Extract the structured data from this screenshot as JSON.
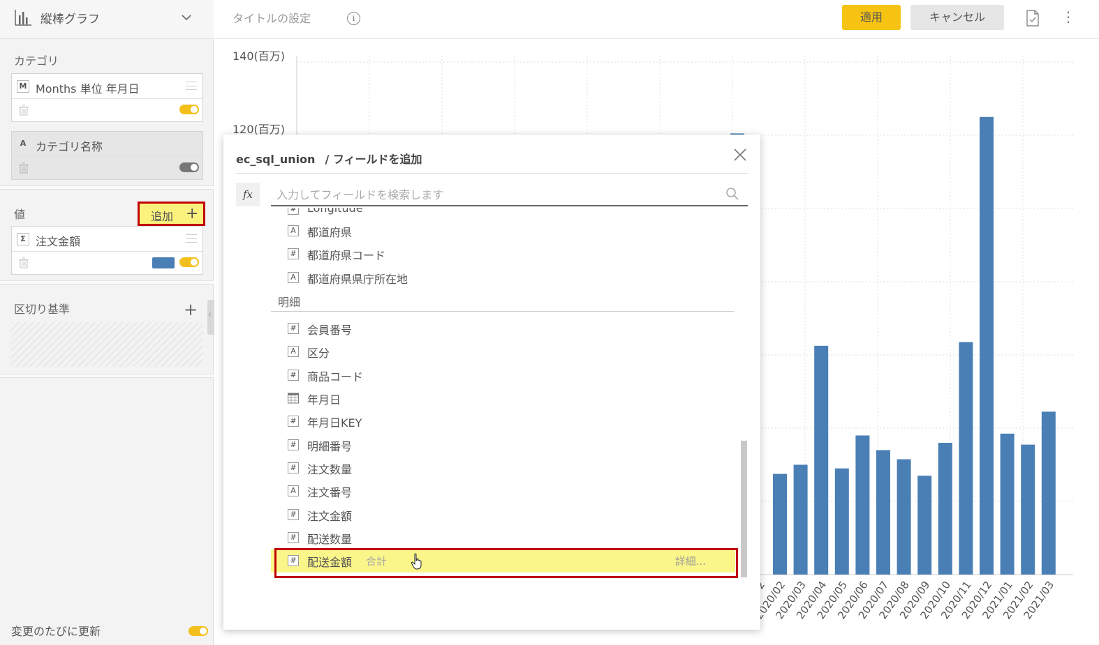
{
  "left_panel": {
    "chart_type_label": "縦棒グラフ",
    "category_section": "カテゴリ",
    "category_fields": [
      {
        "badge": "M",
        "name": "Months 単位 年月日",
        "toggle": "on"
      },
      {
        "badge": "A",
        "name": "カテゴリ名称",
        "toggle": "off"
      }
    ],
    "value_section": "値",
    "add_label": "追加",
    "value_fields": [
      {
        "badge": "Σ",
        "name": "注文金額",
        "toggle": "on",
        "color": "#4a7fb5"
      }
    ],
    "breakdown_section": "区切り基準",
    "auto_update_label": "変更のたびに更新"
  },
  "toolbar": {
    "title_placeholder": "タイトルの設定",
    "apply_label": "適用",
    "cancel_label": "キャンセル"
  },
  "modal": {
    "source": "ec_sql_union",
    "breadcrumb": "/ フィールドを追加",
    "search_placeholder": "入力してフィールドを検索します",
    "partial_item": "Longitude",
    "items_top": [
      {
        "type": "A",
        "name": "都道府県"
      },
      {
        "type": "#",
        "name": "都道府県コード"
      },
      {
        "type": "A",
        "name": "都道府県県庁所在地"
      }
    ],
    "group_name": "明細",
    "items_group": [
      {
        "type": "#",
        "name": "会員番号"
      },
      {
        "type": "A",
        "name": "区分"
      },
      {
        "type": "#",
        "name": "商品コード"
      },
      {
        "type": "cal",
        "name": "年月日"
      },
      {
        "type": "#",
        "name": "年月日KEY"
      },
      {
        "type": "#",
        "name": "明細番号"
      },
      {
        "type": "#",
        "name": "注文数量"
      },
      {
        "type": "A",
        "name": "注文番号"
      },
      {
        "type": "#",
        "name": "注文金額"
      },
      {
        "type": "#",
        "name": "配送数量"
      }
    ],
    "highlighted_item": {
      "type": "#",
      "name": "配送金額",
      "aggregation": "合計",
      "detail": "詳細..."
    }
  },
  "chart_data": {
    "type": "bar",
    "y_tick_labels": [
      "140(百万)",
      "120(百万)"
    ],
    "ylim": [
      0,
      140
    ],
    "bar_color": "#4a7fb5",
    "categories": [
      "2020/02",
      "2020/03",
      "2020/04",
      "2020/05",
      "2020/06",
      "2020/07",
      "2020/08",
      "2020/09",
      "2020/10",
      "2020/11",
      "2020/12",
      "2021/01",
      "2021/02",
      "2021/03"
    ],
    "values": [
      27.5,
      30,
      62.5,
      29,
      38,
      34,
      31.5,
      27,
      36,
      63.5,
      125,
      38.5,
      35.5,
      44.5
    ],
    "hidden_bar_value": 120.5,
    "partial_category": "20/02"
  }
}
